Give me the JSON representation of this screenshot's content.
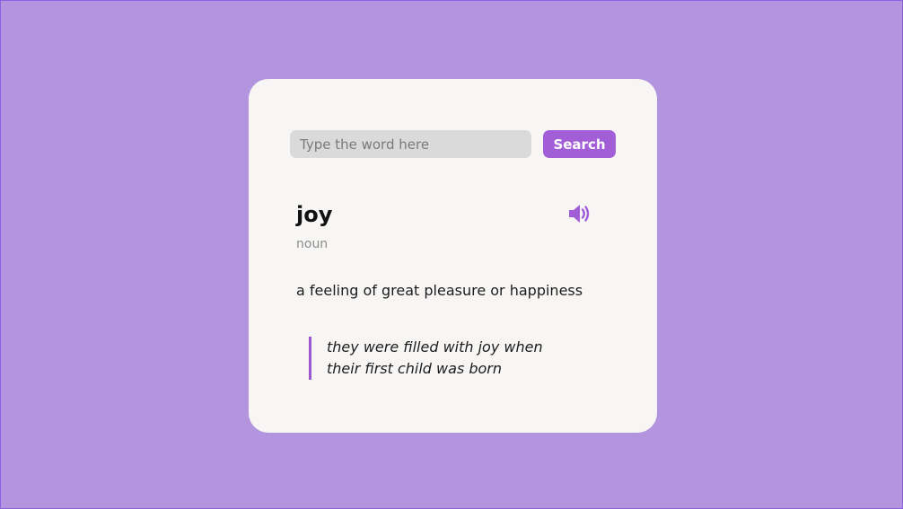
{
  "search": {
    "placeholder": "Type the word here",
    "value": "",
    "button_label": "Search"
  },
  "entry": {
    "word": "joy",
    "part_of_speech": "noun",
    "definition": "a feeling of great pleasure or happiness",
    "example": "they were filled with joy when their first child was born",
    "audio_icon": "speaker-icon"
  },
  "colors": {
    "background": "#b294df",
    "card": "#f7f6f5",
    "accent": "#a25ed6",
    "input": "#dadada"
  }
}
